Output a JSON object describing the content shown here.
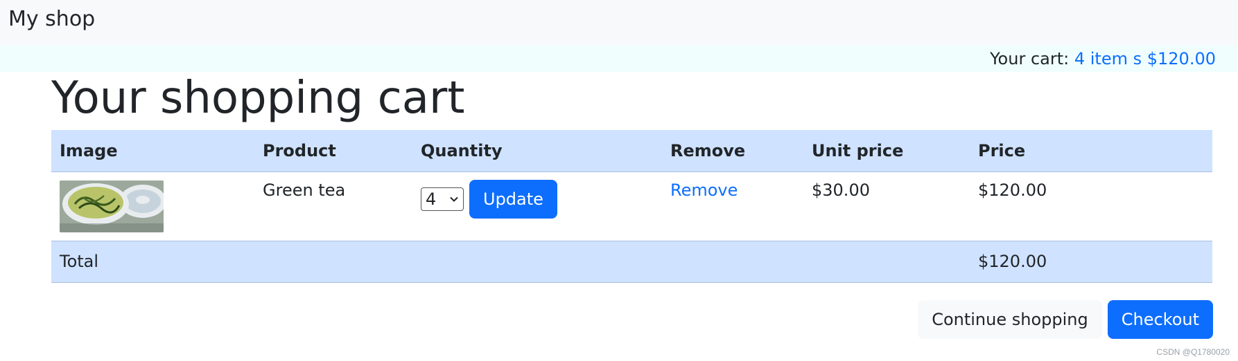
{
  "navbar": {
    "brand": "My shop"
  },
  "cart_summary": {
    "label": "Your cart:",
    "link_text": "4 item s $120.00"
  },
  "page": {
    "title": "Your shopping cart"
  },
  "table": {
    "headers": {
      "image": "Image",
      "product": "Product",
      "quantity": "Quantity",
      "remove": "Remove",
      "unit_price": "Unit price",
      "price": "Price"
    },
    "rows": [
      {
        "product": "Green tea",
        "quantity": "4",
        "update_label": "Update",
        "remove_label": "Remove",
        "unit_price": "$30.00",
        "price": "$120.00"
      }
    ],
    "total_label": "Total",
    "total_value": "$120.00"
  },
  "actions": {
    "continue_label": "Continue shopping",
    "checkout_label": "Checkout"
  },
  "watermark": "CSDN @Q1780020",
  "colors": {
    "accent": "#0d6efd",
    "table_header_bg": "#cfe2ff",
    "navbar_bg": "#f8f9fa",
    "cartbar_bg": "#f0fffe"
  }
}
